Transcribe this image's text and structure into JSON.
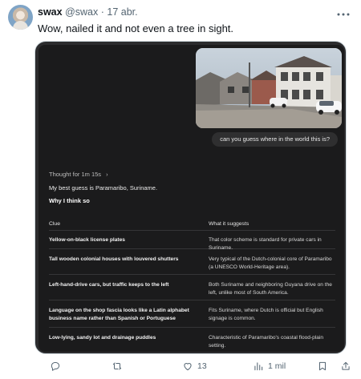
{
  "tweet": {
    "author_name": "swax",
    "author_handle": "@swax",
    "separator": "·",
    "date": "17 abr.",
    "text": "Wow, nailed it and not even a tree in sight.",
    "more_icon": "more-icon"
  },
  "chat": {
    "user_message": "can you guess where in the world this is?",
    "thought": "Thought for 1m 15s",
    "thought_chevron": "›",
    "best_guess": "My best guess is Paramaribo, Suriname.",
    "why_heading": "Why I think so",
    "table": {
      "headers": [
        "Clue",
        "What it suggests"
      ],
      "rows": [
        {
          "clue": "Yellow-on-black license plates",
          "suggests": "That color scheme is standard for private cars in Suriname."
        },
        {
          "clue": "Tall wooden colonial houses with louvered shutters",
          "suggests": "Very typical of the Dutch-colonial core of Paramaribo (a UNESCO World-Heritage area)."
        },
        {
          "clue": "Left-hand-drive cars, but traffic keeps to the left",
          "suggests": "Both Suriname and neighboring Guyana drive on the left, unlike most of South America."
        },
        {
          "clue": "Language on the shop fascia looks like a Latin alphabet business name rather than Spanish or Portuguese",
          "suggests": "Fits Suriname, where Dutch is official but English signage is common."
        },
        {
          "clue": "Low-lying, sandy lot and drainage puddles",
          "suggests": "Characteristic of Paramaribo's coastal flood-plain setting."
        }
      ]
    }
  },
  "actions": {
    "reply_count": "",
    "retweet_count": "",
    "like_count": "13",
    "views_count": "1 mil",
    "icons": [
      "reply-icon",
      "retweet-icon",
      "like-icon",
      "views-icon",
      "bookmark-icon",
      "share-icon"
    ]
  }
}
